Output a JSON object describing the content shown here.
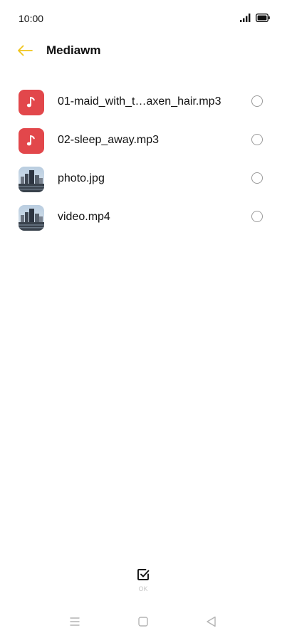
{
  "status_bar": {
    "time": "10:00"
  },
  "header": {
    "title": "Mediawm",
    "back_icon": "arrow-left-icon",
    "accent_color": "#f0c419"
  },
  "files": [
    {
      "name": "01-maid_with_t…axen_hair.mp3",
      "type": "audio",
      "icon": "music-note-icon",
      "selected": false
    },
    {
      "name": "02-sleep_away.mp3",
      "type": "audio",
      "icon": "music-note-icon",
      "selected": false
    },
    {
      "name": "photo.jpg",
      "type": "image",
      "icon": "image-thumbnail",
      "selected": false
    },
    {
      "name": "video.mp4",
      "type": "video",
      "icon": "video-thumbnail",
      "selected": false
    }
  ],
  "footer": {
    "ok_label": "OK",
    "ok_icon": "checkbox-check-icon"
  },
  "nav": {
    "menu_icon": "menu-icon",
    "home_icon": "home-square-icon",
    "back_icon": "back-triangle-icon"
  },
  "colors": {
    "audio_thumb": "#e2474b",
    "radio_border": "#9a9a9a",
    "ok_label": "#c7c7c7"
  }
}
